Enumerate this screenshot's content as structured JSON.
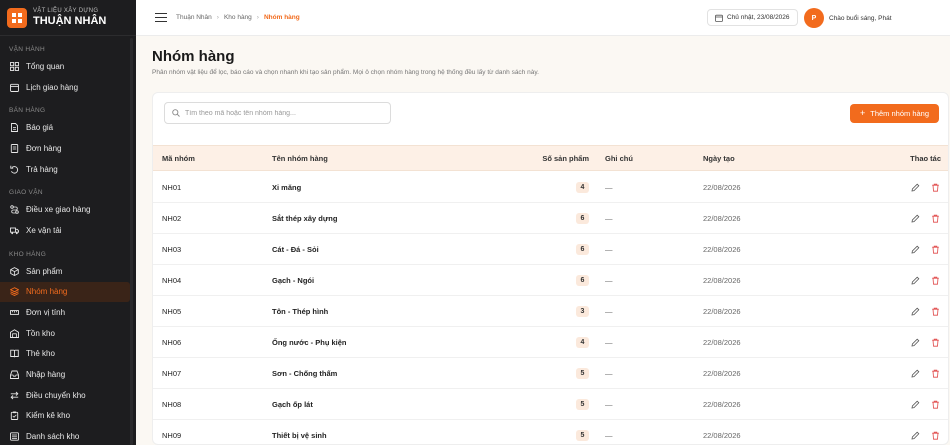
{
  "brand": {
    "subtitle": "VẬT LIỆU XÂY DỰNG",
    "name": "THUẬN NHÂN"
  },
  "sidebar": {
    "sections": [
      {
        "title": "VẬN HÀNH",
        "items": [
          {
            "label": "Tổng quan",
            "icon": "grid-icon"
          },
          {
            "label": "Lịch giao hàng",
            "icon": "calendar-icon"
          }
        ]
      },
      {
        "title": "BÁN HÀNG",
        "items": [
          {
            "label": "Báo giá",
            "icon": "document-icon"
          },
          {
            "label": "Đơn hàng",
            "icon": "receipt-icon"
          },
          {
            "label": "Trả hàng",
            "icon": "return-icon"
          }
        ]
      },
      {
        "title": "GIAO VẬN",
        "items": [
          {
            "label": "Điều xe giao hàng",
            "icon": "route-icon"
          },
          {
            "label": "Xe vận tải",
            "icon": "truck-icon"
          }
        ]
      },
      {
        "title": "KHO HÀNG",
        "items": [
          {
            "label": "Sản phẩm",
            "icon": "box-icon"
          },
          {
            "label": "Nhóm hàng",
            "icon": "layers-icon",
            "active": true
          },
          {
            "label": "Đơn vị tính",
            "icon": "ruler-icon"
          },
          {
            "label": "Tồn kho",
            "icon": "warehouse-icon"
          },
          {
            "label": "Thẻ kho",
            "icon": "book-icon"
          },
          {
            "label": "Nhập hàng",
            "icon": "inbox-icon"
          },
          {
            "label": "Điều chuyển kho",
            "icon": "transfer-icon"
          },
          {
            "label": "Kiểm kê kho",
            "icon": "clipboard-icon"
          },
          {
            "label": "Danh sách kho",
            "icon": "list-icon"
          }
        ]
      }
    ]
  },
  "breadcrumb": [
    "Thuận Nhân",
    "Kho hàng",
    "Nhóm hàng"
  ],
  "header": {
    "date": "Chủ nhật, 23/08/2026",
    "user_name": "Chào buổi sáng, Phát",
    "user_initial": "P"
  },
  "page": {
    "title": "Nhóm hàng",
    "description": "Phân nhóm vật liệu để lọc, báo cáo và chọn nhanh khi tạo sản phẩm. Mọi ô chọn nhóm hàng trong hệ thống đều lấy từ danh sách này."
  },
  "search": {
    "placeholder": "Tìm theo mã hoặc tên nhóm hàng..."
  },
  "add_button": {
    "label": "Thêm nhóm hàng"
  },
  "table": {
    "columns": {
      "code": "Mã nhóm",
      "name": "Tên nhóm hàng",
      "count": "Số sản phẩm",
      "note": "Ghi chú",
      "date": "Ngày tạo",
      "actions": "Thao tác"
    },
    "rows": [
      {
        "code": "NH01",
        "name": "Xi măng",
        "count": "4",
        "note": "—",
        "date": "22/08/2026"
      },
      {
        "code": "NH02",
        "name": "Sắt thép xây dựng",
        "count": "6",
        "note": "—",
        "date": "22/08/2026"
      },
      {
        "code": "NH03",
        "name": "Cát - Đá - Sỏi",
        "count": "6",
        "note": "—",
        "date": "22/08/2026"
      },
      {
        "code": "NH04",
        "name": "Gạch - Ngói",
        "count": "6",
        "note": "—",
        "date": "22/08/2026"
      },
      {
        "code": "NH05",
        "name": "Tôn - Thép hình",
        "count": "3",
        "note": "—",
        "date": "22/08/2026"
      },
      {
        "code": "NH06",
        "name": "Ống nước - Phụ kiện",
        "count": "4",
        "note": "—",
        "date": "22/08/2026"
      },
      {
        "code": "NH07",
        "name": "Sơn - Chống thấm",
        "count": "5",
        "note": "—",
        "date": "22/08/2026"
      },
      {
        "code": "NH08",
        "name": "Gạch ốp lát",
        "count": "5",
        "note": "—",
        "date": "22/08/2026"
      },
      {
        "code": "NH09",
        "name": "Thiết bị vệ sinh",
        "count": "5",
        "note": "—",
        "date": "22/08/2026"
      }
    ]
  },
  "colors": {
    "accent": "#f26b1d",
    "sidebar_bg": "#1d1d1f",
    "header_row_bg": "#fdf0e6",
    "delete": "#e04848"
  }
}
